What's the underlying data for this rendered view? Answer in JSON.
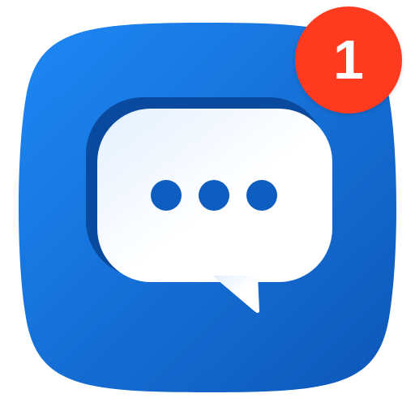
{
  "app_icon": {
    "icon_name": "chat-bubble-icon",
    "colors": {
      "background_light": "#1E88F5",
      "background_dark": "#0D57B8",
      "bubble_light": "#FFFFFF",
      "bubble_tint": "#E4F0FE",
      "dots": "#0E5DC0",
      "shadow": "#0A4A9E"
    }
  },
  "badge": {
    "count": "1",
    "color": "#FF3A1E"
  }
}
